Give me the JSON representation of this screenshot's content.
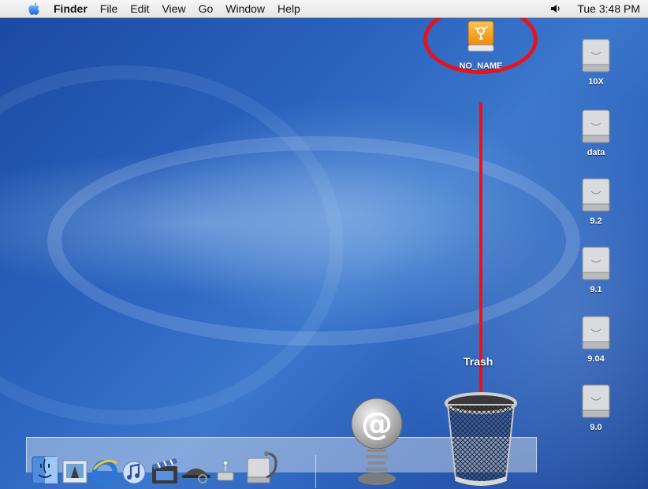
{
  "menubar": {
    "apple_icon": "apple-logo-icon",
    "items": [
      "Finder",
      "File",
      "Edit",
      "View",
      "Go",
      "Window",
      "Help"
    ],
    "volume_icon": "speaker-icon",
    "clock": "Tue 3:48 PM"
  },
  "desktop": {
    "firewire_drive": {
      "label": "NO_NAME",
      "icon": "firewire-drive-icon"
    },
    "disks": [
      {
        "label": "10X",
        "icon": "hard-disk-icon"
      },
      {
        "label": "data",
        "icon": "hard-disk-icon"
      },
      {
        "label": "9.2",
        "icon": "hard-disk-icon"
      },
      {
        "label": "9.1",
        "icon": "hard-disk-icon"
      },
      {
        "label": "9.04",
        "icon": "hard-disk-icon"
      },
      {
        "label": "9.0",
        "icon": "hard-disk-icon"
      }
    ],
    "annotation": {
      "color": "#e5141b"
    }
  },
  "dock": {
    "items": [
      {
        "name": "finder-icon"
      },
      {
        "name": "preview-icon"
      },
      {
        "name": "internet-explorer-icon"
      },
      {
        "name": "itunes-icon"
      },
      {
        "name": "imovie-icon"
      },
      {
        "name": "sherlock-icon"
      },
      {
        "name": "system-preferences-icon"
      },
      {
        "name": "disk-utility-icon"
      },
      {
        "name": "mail-icon"
      },
      {
        "name": "trash-icon"
      }
    ],
    "trash_label": "Trash"
  }
}
